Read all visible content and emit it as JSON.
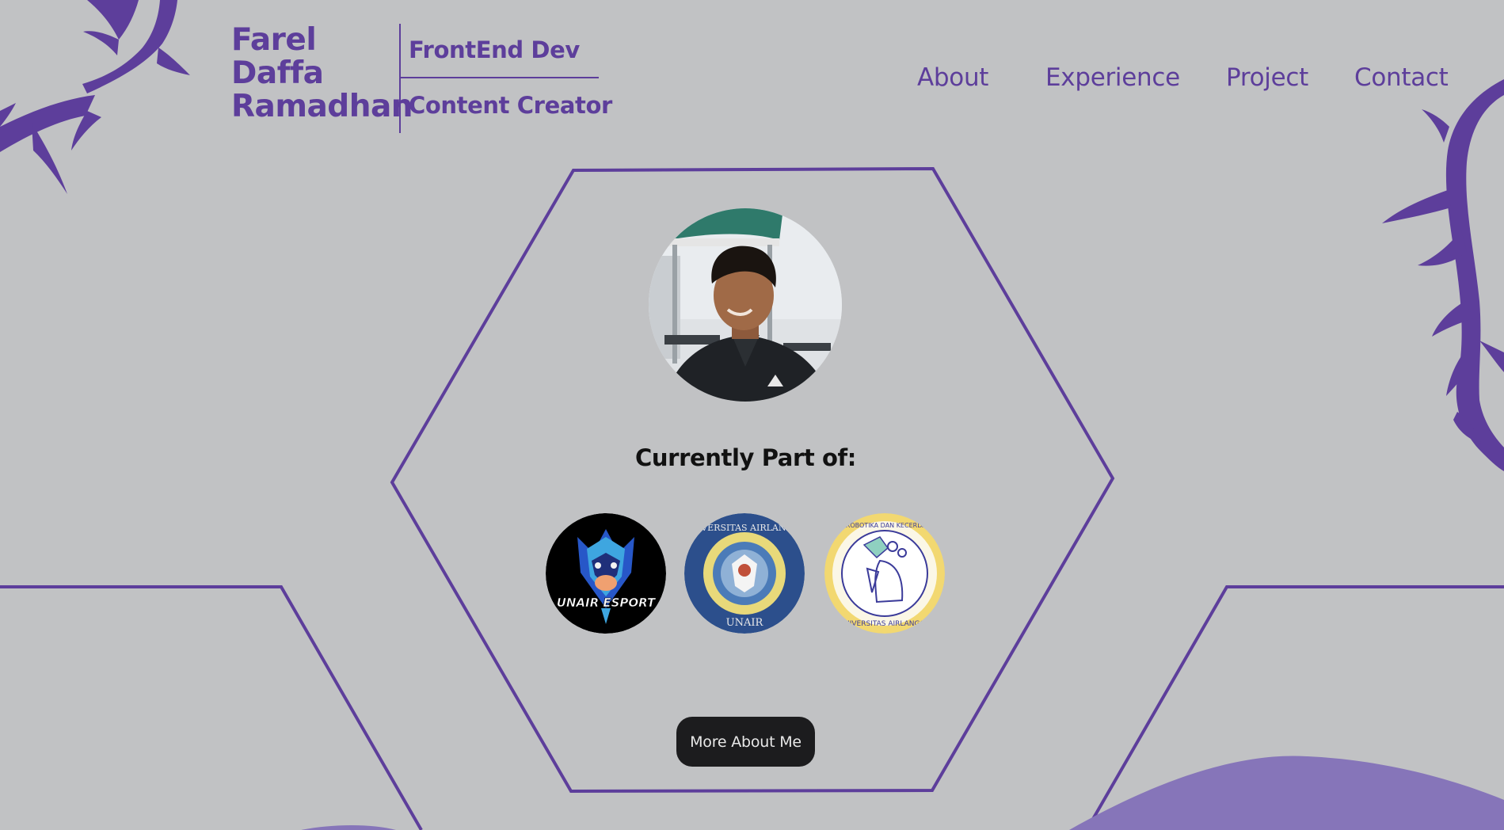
{
  "header": {
    "name_lines": [
      "Farel",
      "Daffa",
      "Ramadhan"
    ],
    "roles": [
      "FrontEnd Dev",
      "Content Creator"
    ]
  },
  "nav": {
    "items": [
      {
        "label": "About"
      },
      {
        "label": "Experience"
      },
      {
        "label": "Project"
      },
      {
        "label": "Contact"
      }
    ]
  },
  "hero": {
    "currently_label": "Currently Part of:",
    "organizations": [
      {
        "label": "UNAIR ESPORT",
        "icon": "unair-esport-logo"
      },
      {
        "label": "UNIVERSITAS AIRLANGGA",
        "icon": "universitas-airlangga-seal"
      },
      {
        "label": "HIMA TEKNIK ROBOTIKA DAN KECERDASAN BUATAN · UNIVERSITAS AIRLANGGA",
        "icon": "hima-trkb-logo"
      }
    ],
    "cta_label": "More About Me"
  },
  "theme": {
    "background": "#c1c2c4",
    "accent": "#5d3e9b",
    "button_bg": "#1c1c1e"
  }
}
